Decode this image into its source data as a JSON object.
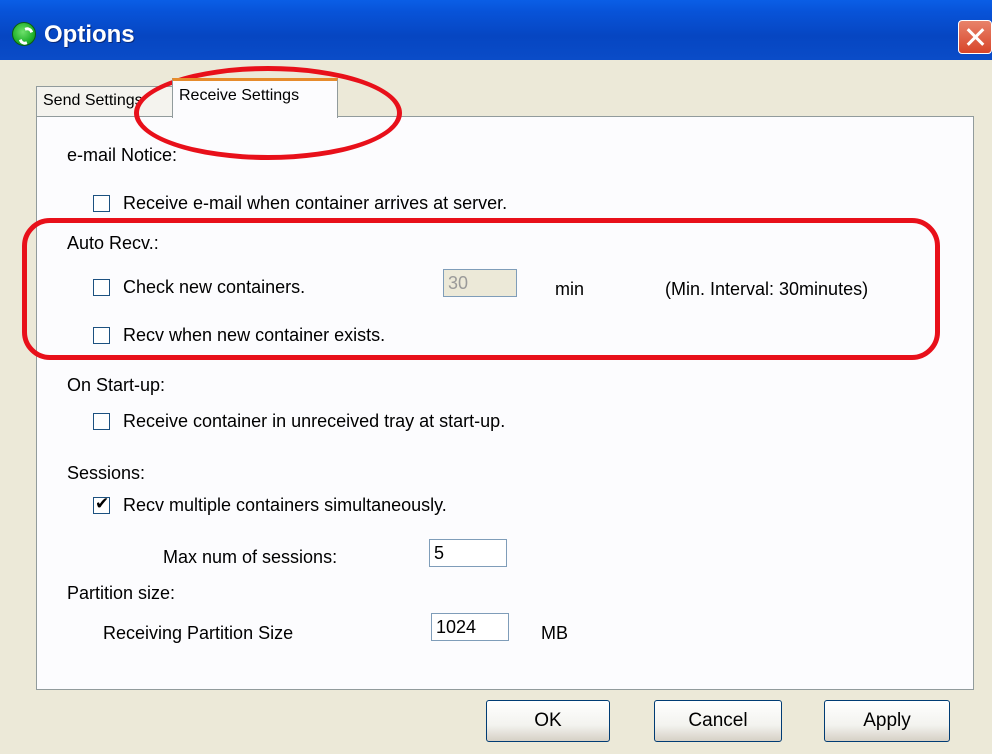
{
  "window": {
    "title": "Options"
  },
  "tabs": [
    {
      "label": "Send Settings",
      "active": false
    },
    {
      "label": "Receive Settings",
      "active": true
    }
  ],
  "email_notice": {
    "heading": "e-mail Notice:",
    "receive_email": {
      "label": "Receive e-mail when container arrives at server.",
      "checked": false
    }
  },
  "auto_recv": {
    "heading": "Auto Recv.:",
    "check_new": {
      "label": "Check new containers.",
      "checked": false
    },
    "interval_value": "30",
    "interval_unit": "min",
    "interval_note": "(Min. Interval: 30minutes)",
    "recv_when_exists": {
      "label": "Recv when new container exists.",
      "checked": false
    }
  },
  "startup": {
    "heading": "On Start-up:",
    "receive_unreceived": {
      "label": "Receive container in unreceived tray at start-up.",
      "checked": false
    }
  },
  "sessions": {
    "heading": "Sessions:",
    "multiple": {
      "label": "Recv multiple containers simultaneously.",
      "checked": true
    },
    "max_label": "Max num of sessions:",
    "max_value": "5"
  },
  "partition": {
    "heading": "Partition size:",
    "label": "Receiving Partition Size",
    "value": "1024",
    "unit": "MB"
  },
  "buttons": {
    "ok": "OK",
    "cancel": "Cancel",
    "apply": "Apply"
  },
  "colors": {
    "titlebar": "#0a4cc8",
    "highlight": "#e8101a",
    "dialog_bg": "#ece9d8"
  }
}
